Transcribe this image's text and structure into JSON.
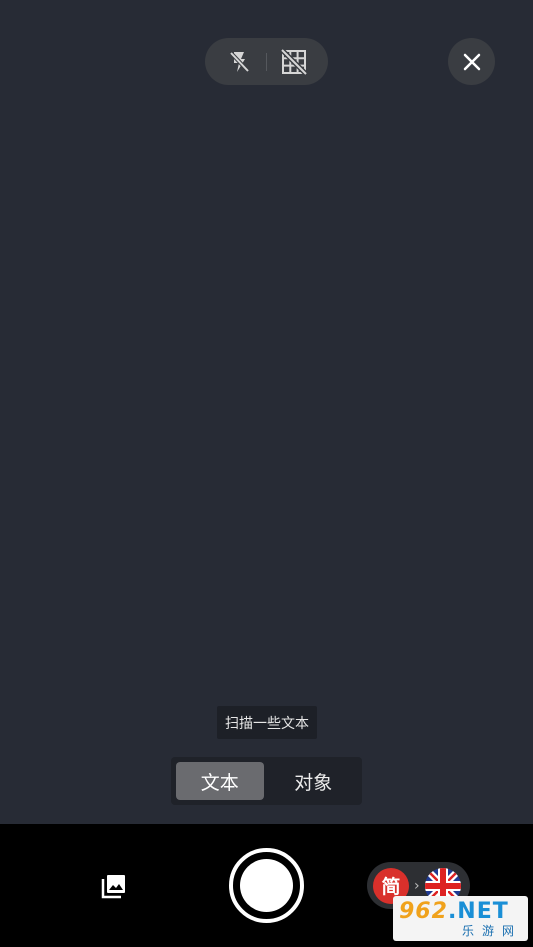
{
  "top_controls": {
    "flash_icon": "flash-off-icon",
    "grid_icon": "grid-off-icon",
    "close_icon": "close-icon"
  },
  "hint": "扫描一些文本",
  "modes": [
    {
      "label": "文本",
      "active": true
    },
    {
      "label": "对象",
      "active": false
    }
  ],
  "bottom_bar": {
    "gallery_icon": "gallery-icon",
    "shutter_icon": "shutter-button",
    "language": {
      "source": "简",
      "arrow": "›",
      "target_icon": "uk-flag-icon"
    }
  },
  "watermark": {
    "logo_num": "962",
    "logo_suffix": ".NET",
    "subtitle": "乐游网"
  }
}
